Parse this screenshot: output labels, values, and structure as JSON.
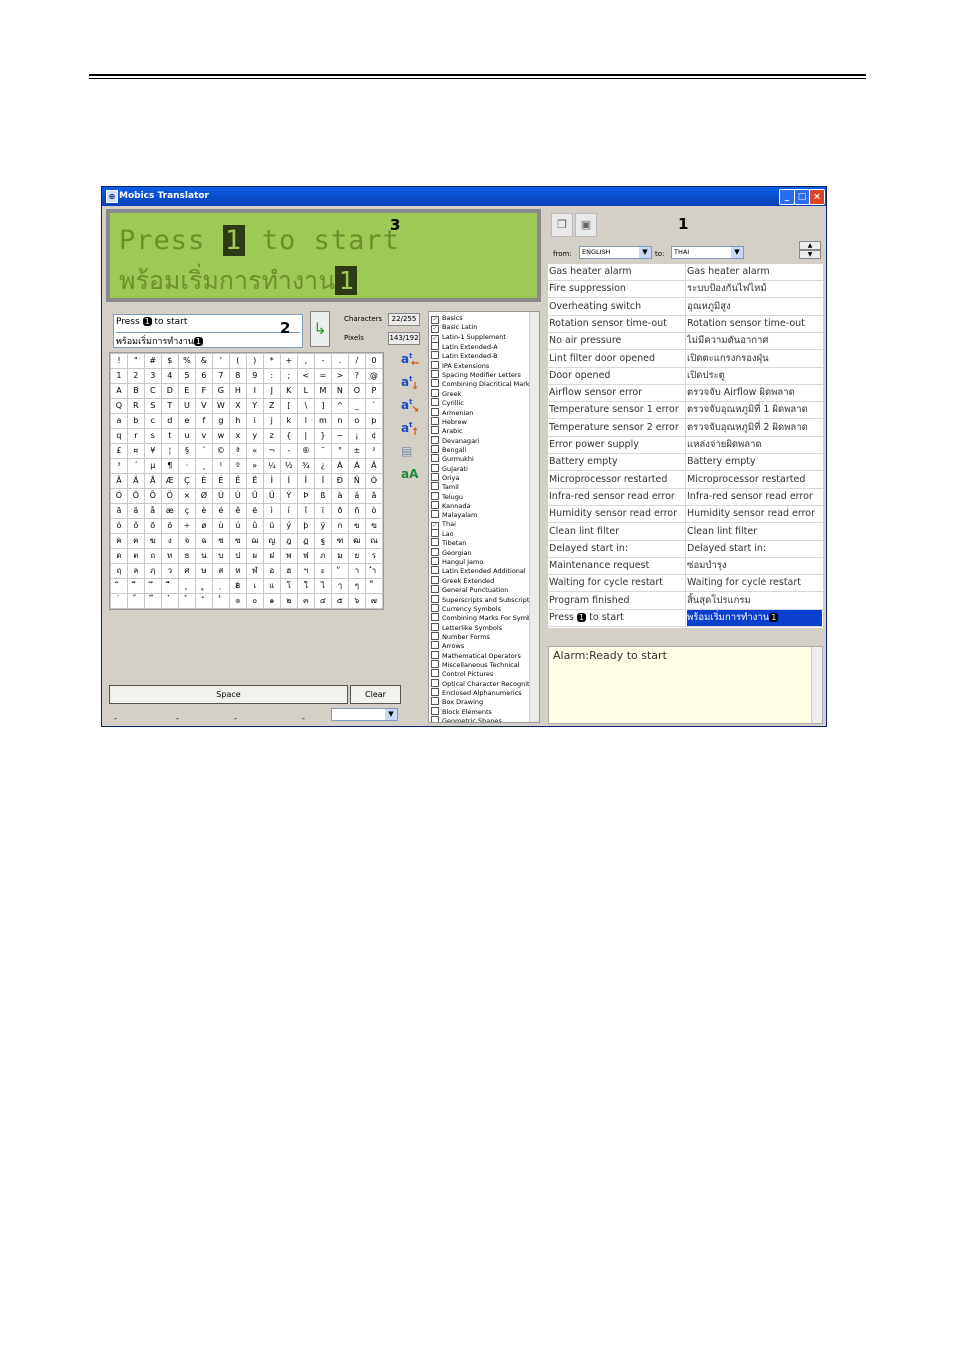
{
  "window": {
    "title": "Mobics Translator"
  },
  "callouts": {
    "one": "1",
    "two": "2",
    "three": "3"
  },
  "lcd": {
    "line1_pre": "Press ",
    "line1_key": "1",
    "line1_post": " to start",
    "line2_text": "พร้อมเริ่มการทำงาน",
    "line2_key": "1"
  },
  "editor": {
    "line1_pre": "Press ",
    "line1_key": "1",
    "line1_post": " to start",
    "line2_text": "พร้อมเริ่มการทำงาน",
    "line2_key": "1"
  },
  "stats": {
    "characters_label": "Characters",
    "characters_value": "22/255",
    "pixels_label": "Pixels",
    "pixels_value": "143/192"
  },
  "char_grid": [
    [
      "!",
      "\"",
      "#",
      "$",
      "%",
      "&",
      "'",
      "(",
      ")",
      "*",
      "+",
      ",",
      "-",
      ".",
      "/",
      "0"
    ],
    [
      "1",
      "2",
      "3",
      "4",
      "5",
      "6",
      "7",
      "8",
      "9",
      ":",
      ";",
      "<",
      "=",
      ">",
      "?",
      "@"
    ],
    [
      "A",
      "B",
      "C",
      "D",
      "E",
      "F",
      "G",
      "H",
      "I",
      "J",
      "K",
      "L",
      "M",
      "N",
      "O",
      "P"
    ],
    [
      "Q",
      "R",
      "S",
      "T",
      "U",
      "V",
      "W",
      "X",
      "Y",
      "Z",
      "[",
      "\\",
      "]",
      "^",
      "_",
      "`"
    ],
    [
      "a",
      "b",
      "c",
      "d",
      "e",
      "f",
      "g",
      "h",
      "i",
      "j",
      "k",
      "l",
      "m",
      "n",
      "o",
      "p"
    ],
    [
      "q",
      "r",
      "s",
      "t",
      "u",
      "v",
      "w",
      "x",
      "y",
      "z",
      "{",
      "|",
      "}",
      "~",
      "¡",
      "¢"
    ],
    [
      "£",
      "¤",
      "¥",
      "¦",
      "§",
      "¨",
      "©",
      "ª",
      "«",
      "¬",
      "-",
      "®",
      "¯",
      "°",
      "±",
      "²"
    ],
    [
      "³",
      "´",
      "µ",
      "¶",
      "·",
      "¸",
      "¹",
      "º",
      "»",
      "¼",
      "½",
      "¾",
      "¿",
      "À",
      "Á",
      "Â"
    ],
    [
      "Ã",
      "Ä",
      "Å",
      "Æ",
      "Ç",
      "È",
      "É",
      "Ê",
      "Ë",
      "Ì",
      "Í",
      "Î",
      "Ï",
      "Ð",
      "Ñ",
      "Ò"
    ],
    [
      "Ó",
      "Ô",
      "Õ",
      "Ö",
      "×",
      "Ø",
      "Ù",
      "Ú",
      "Û",
      "Ü",
      "Ý",
      "Þ",
      "ß",
      "à",
      "á",
      "â"
    ],
    [
      "ã",
      "ä",
      "å",
      "æ",
      "ç",
      "è",
      "é",
      "ê",
      "ë",
      "ì",
      "í",
      "î",
      "ï",
      "ð",
      "ñ",
      "ò"
    ],
    [
      "ó",
      "ô",
      "õ",
      "ö",
      "÷",
      "ø",
      "ù",
      "ú",
      "û",
      "ü",
      "ý",
      "þ",
      "ÿ",
      "ก",
      "ข",
      "ฃ"
    ],
    [
      "ค",
      "ฅ",
      "ฆ",
      "ง",
      "จ",
      "ฉ",
      "ช",
      "ซ",
      "ฌ",
      "ญ",
      "ฎ",
      "ฏ",
      "ฐ",
      "ฑ",
      "ฒ",
      "ณ"
    ],
    [
      "ด",
      "ต",
      "ถ",
      "ท",
      "ธ",
      "น",
      "บ",
      "ป",
      "ผ",
      "ฝ",
      "พ",
      "ฟ",
      "ภ",
      "ม",
      "ย",
      "ร"
    ],
    [
      "ฤ",
      "ล",
      "ฦ",
      "ว",
      "ศ",
      "ษ",
      "ส",
      "ห",
      "ฬ",
      "อ",
      "ฮ",
      "ฯ",
      "ะ",
      "ั",
      "า",
      "ำ"
    ],
    [
      "ิ",
      "ี",
      "ึ",
      "ื",
      "ุ",
      "ู",
      "ฺ",
      "฿",
      "เ",
      "แ",
      "โ",
      "ใ",
      "ไ",
      "ๅ",
      "ๆ",
      "็"
    ],
    [
      "่",
      "้",
      "๊",
      "๋",
      "์",
      "ํ",
      "๎",
      "๏",
      "๐",
      "๑",
      "๒",
      "๓",
      "๔",
      "๕",
      "๖",
      "๗"
    ],
    [
      "๘",
      "๙",
      "๚",
      "๛",
      "",
      "",
      "",
      "",
      "",
      "",
      "",
      "",
      "",
      "",
      "",
      ""
    ]
  ],
  "buttons": {
    "space": "Space",
    "clear": "Clear",
    "dash1": "-",
    "dash2": "-",
    "dash3": "-",
    "dash4": "-"
  },
  "unicode_blocks": [
    {
      "label": "Basics",
      "checked": true
    },
    {
      "label": "Basic Latin",
      "checked": true
    },
    {
      "label": "Latin-1 Supplement",
      "checked": true
    },
    {
      "label": "Latin Extended-A",
      "checked": false
    },
    {
      "label": "Latin Extended-B",
      "checked": false
    },
    {
      "label": "IPA Extensions",
      "checked": false
    },
    {
      "label": "Spacing Modifier Letters",
      "checked": false
    },
    {
      "label": "Combining Diacritical Marks",
      "checked": false
    },
    {
      "label": "Greek",
      "checked": false
    },
    {
      "label": "Cyrillic",
      "checked": false
    },
    {
      "label": "Armenian",
      "checked": false
    },
    {
      "label": "Hebrew",
      "checked": false
    },
    {
      "label": "Arabic",
      "checked": false
    },
    {
      "label": "Devanagari",
      "checked": false
    },
    {
      "label": "Bengali",
      "checked": false
    },
    {
      "label": "Gurmukhi",
      "checked": false
    },
    {
      "label": "Gujarati",
      "checked": false
    },
    {
      "label": "Oriya",
      "checked": false
    },
    {
      "label": "Tamil",
      "checked": false
    },
    {
      "label": "Telugu",
      "checked": false
    },
    {
      "label": "Kannada",
      "checked": false
    },
    {
      "label": "Malayalam",
      "checked": false
    },
    {
      "label": "Thai",
      "checked": true
    },
    {
      "label": "Lao",
      "checked": false
    },
    {
      "label": "Tibetan",
      "checked": false
    },
    {
      "label": "Georgian",
      "checked": false
    },
    {
      "label": "Hangul Jamo",
      "checked": false
    },
    {
      "label": "Latin Extended Additional",
      "checked": false
    },
    {
      "label": "Greek Extended",
      "checked": false
    },
    {
      "label": "General Punctuation",
      "checked": false
    },
    {
      "label": "Superscripts and Subscripts",
      "checked": false
    },
    {
      "label": "Currency Symbols",
      "checked": false
    },
    {
      "label": "Combining Marks For Symbols",
      "checked": false
    },
    {
      "label": "Letterlike Symbols",
      "checked": false
    },
    {
      "label": "Number Forms",
      "checked": false
    },
    {
      "label": "Arrows",
      "checked": false
    },
    {
      "label": "Mathematical Operators",
      "checked": false
    },
    {
      "label": "Miscellaneous Technical",
      "checked": false
    },
    {
      "label": "Control Pictures",
      "checked": false
    },
    {
      "label": "Optical Character Recognition",
      "checked": false
    },
    {
      "label": "Enclosed Alphanumerics",
      "checked": false
    },
    {
      "label": "Box Drawing",
      "checked": false
    },
    {
      "label": "Block Elements",
      "checked": false
    },
    {
      "label": "Geometric Shapes",
      "checked": false
    }
  ],
  "translator": {
    "from_label": "from:",
    "from_value": "ENGLISH",
    "to_label": "to:",
    "to_value": "THAI",
    "rows": [
      {
        "src": "Gas heater alarm",
        "dst": "Gas heater alarm"
      },
      {
        "src": "Fire suppression",
        "dst": "ระบบป้องกันไฟไหม้"
      },
      {
        "src": "Overheating switch",
        "dst": "อุณหภูมิสูง"
      },
      {
        "src": "Rotation sensor time-out",
        "dst": "Rotation sensor time-out"
      },
      {
        "src": "No air pressure",
        "dst": "ไม่มีความดันอากาศ"
      },
      {
        "src": "Lint filter door opened",
        "dst": "เปิดตะแกรงกรองฝุ่น"
      },
      {
        "src": "Door opened",
        "dst": "เปิดประตู"
      },
      {
        "src": "Airflow sensor error",
        "dst": "ตรวจจับ Airflow ผิดพลาด"
      },
      {
        "src": "Temperature sensor 1 error",
        "dst": "ตรวจจับอุณหภูมิที่ 1 ผิดพลาด"
      },
      {
        "src": "Temperature sensor 2 error",
        "dst": "ตรวจจับอุณหภูมิที่ 2 ผิดพลาด"
      },
      {
        "src": "Error power supply",
        "dst": "แหล่งจ่ายผิดพลาด"
      },
      {
        "src": "Battery empty",
        "dst": "Battery empty"
      },
      {
        "src": "Microprocessor restarted",
        "dst": "Microprocessor restarted"
      },
      {
        "src": "Infra-red sensor read error",
        "dst": "Infra-red sensor read error"
      },
      {
        "src": "Humidity sensor read error",
        "dst": "Humidity sensor read error"
      },
      {
        "src": "Clean lint filter",
        "dst": "Clean lint filter"
      },
      {
        "src": "Delayed start in:",
        "dst": "Delayed start in:"
      },
      {
        "src": "Maintenance request",
        "dst": "ซ่อมบำรุง"
      },
      {
        "src": "Waiting for cycle restart",
        "dst": "Waiting for cycle restart"
      },
      {
        "src": "Program finished",
        "dst": "สิ้นสุดโปรแกรม"
      },
      {
        "src_pre": "Press ",
        "src_key": "1",
        "src_post": " to start",
        "dst_text": "พร้อมเริ่มการทำงาน",
        "dst_key": "1",
        "selected": true
      }
    ],
    "status": "Alarm:Ready to start"
  }
}
